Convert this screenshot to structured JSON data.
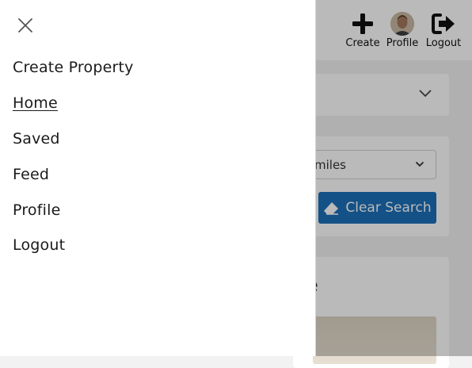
{
  "topbar": {
    "create_label": "Create",
    "profile_label": "Profile",
    "logout_label": "Logout"
  },
  "filters": {
    "distance_value": "miles",
    "clear_search_label": "Clear Search"
  },
  "listing": {
    "title_partial": "le"
  },
  "drawer": {
    "items": [
      {
        "label": "Create Property",
        "active": false
      },
      {
        "label": "Home",
        "active": true
      },
      {
        "label": "Saved",
        "active": false
      },
      {
        "label": "Feed",
        "active": false
      },
      {
        "label": "Profile",
        "active": false
      },
      {
        "label": "Logout",
        "active": false
      }
    ]
  },
  "colors": {
    "accent": "#1c6fb8",
    "overlay": "rgba(0,0,0,0.27)"
  }
}
